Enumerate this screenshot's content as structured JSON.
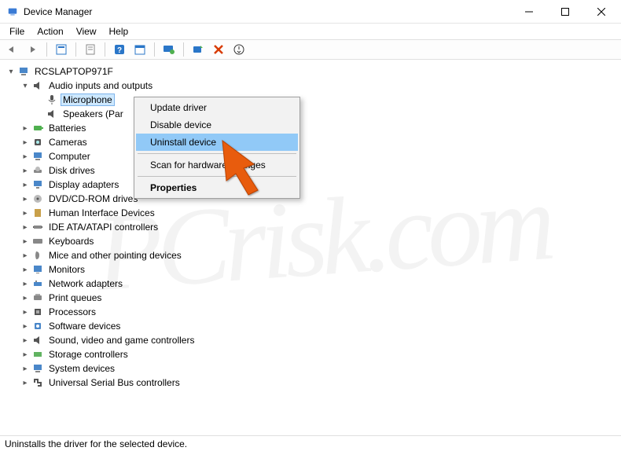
{
  "window": {
    "title": "Device Manager"
  },
  "menubar": {
    "file": "File",
    "action": "Action",
    "view": "View",
    "help": "Help"
  },
  "toolbar": {
    "back": "back-icon",
    "forward": "forward-icon",
    "show_hidden": "show-hidden-icon",
    "properties": "properties-icon",
    "help": "help-icon",
    "calendar": "calendar-icon",
    "monitor": "update-driver-icon",
    "scan": "scan-hardware-icon",
    "delete": "uninstall-icon",
    "updown": "enable-device-icon"
  },
  "tree": {
    "root": "RCSLAPTOP971F",
    "audio": {
      "label": "Audio inputs and outputs",
      "children": {
        "microphone": "Microphone",
        "speakers": "Speakers (Par"
      }
    },
    "categories": [
      "Batteries",
      "Cameras",
      "Computer",
      "Disk drives",
      "Display adapters",
      "DVD/CD-ROM drives",
      "Human Interface Devices",
      "IDE ATA/ATAPI controllers",
      "Keyboards",
      "Mice and other pointing devices",
      "Monitors",
      "Network adapters",
      "Print queues",
      "Processors",
      "Software devices",
      "Sound, video and game controllers",
      "Storage controllers",
      "System devices",
      "Universal Serial Bus controllers"
    ]
  },
  "contextmenu": {
    "update_driver": "Update driver",
    "disable_device": "Disable device",
    "uninstall_device": "Uninstall device",
    "scan_hardware": "Scan for hardware changes",
    "properties": "Properties"
  },
  "statusbar": {
    "text": "Uninstalls the driver for the selected device."
  },
  "watermark": "PCrisk.com"
}
